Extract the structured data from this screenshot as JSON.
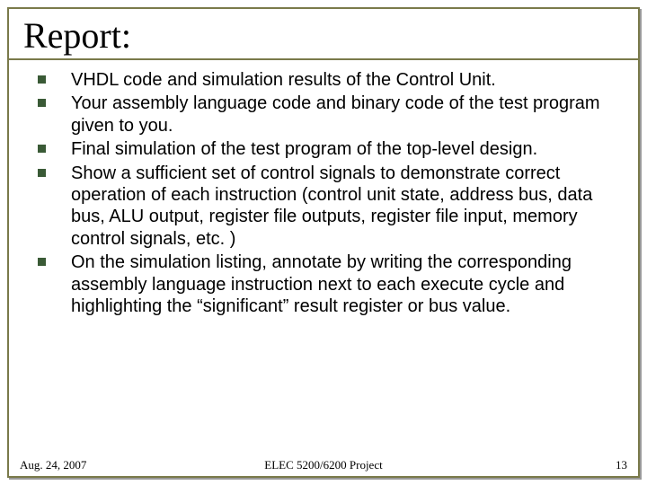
{
  "title": "Report:",
  "bullets": [
    "VHDL code and simulation results of the Control Unit.",
    "Your assembly language code and binary code of the test program given to you.",
    "Final simulation of the test program of the top-level design.",
    "Show a sufficient set of control signals to demonstrate correct operation of each instruction (control unit state, address bus, data bus, ALU output, register file outputs, register file input, memory control signals, etc. )",
    "On the simulation listing, annotate by writing the corresponding assembly language instruction next to each execute cycle and highlighting the “significant” result register or bus value."
  ],
  "footer": {
    "date": "Aug. 24, 2007",
    "center": "ELEC 5200/6200 Project",
    "page": "13"
  }
}
